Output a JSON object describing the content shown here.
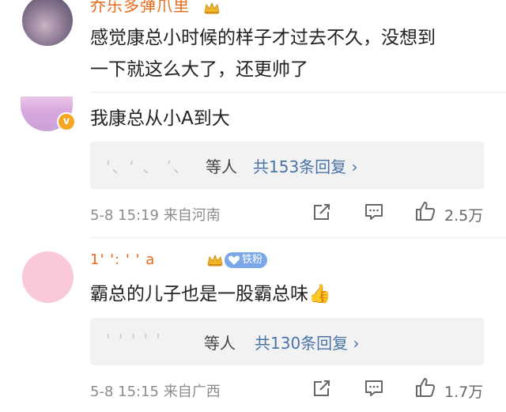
{
  "comments": [
    {
      "username": "乔乐多弹爪里",
      "text_lines": [
        "感觉康总小时候的样子才过去不久，没想到",
        "一下就这么大了，还更帅了"
      ]
    },
    {
      "text": "我康总从小A到大",
      "reply_names": "'、‘  、 ’、",
      "reply_suffix": "等人",
      "reply_link": "共153条回复 ›",
      "time_location": "5-8 15:19  来自河南",
      "likes": "2.5万"
    },
    {
      "username": "1' ':  ' '  a",
      "fan_badge": "铁粉",
      "text": "霸总的儿子也是一股霸总味👍",
      "reply_names": "' ' '  ' '",
      "reply_suffix": "等人",
      "reply_link": "共130条回复 ›",
      "time_location": "5-8 15:15  来自广西",
      "likes": "1.7万"
    }
  ],
  "colors": {
    "username": "#e86a1b",
    "link": "#4a74a8",
    "meta": "#8c8c8c",
    "reply_bg": "#f2f2f2",
    "fan_badge": "#7aa7e8"
  },
  "icons": [
    "crown-icon",
    "verified-icon",
    "share-icon",
    "comment-icon",
    "like-icon",
    "heart-icon"
  ]
}
